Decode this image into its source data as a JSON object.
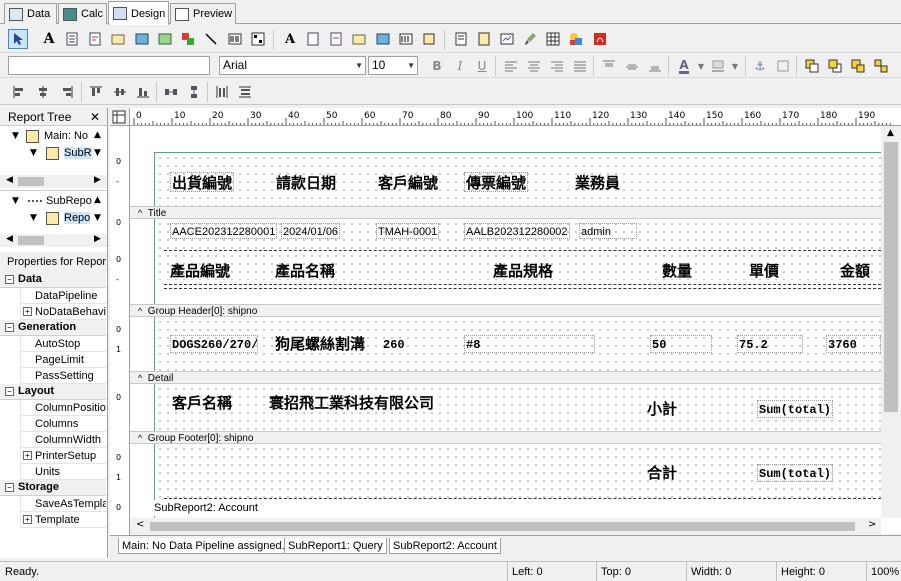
{
  "tabs": [
    {
      "label": "Data"
    },
    {
      "label": "Calc"
    },
    {
      "label": "Design"
    },
    {
      "label": "Preview"
    }
  ],
  "format": {
    "font_name": "Arial",
    "font_size": "10",
    "style_value": ""
  },
  "tree": {
    "title": "Report Tree",
    "nodes": [
      "Main: No",
      "SubR",
      "SubRepo",
      "Repo"
    ]
  },
  "props": {
    "title": "Properties for Repor",
    "sections": [
      {
        "name": "Data",
        "items": [
          "DataPipeline",
          "NoDataBehavio"
        ]
      },
      {
        "name": "Generation",
        "items": [
          "AutoStop",
          "PageLimit",
          "PassSetting"
        ]
      },
      {
        "name": "Layout",
        "items": [
          "ColumnPosition",
          "Columns",
          "ColumnWidth",
          "PrinterSetup",
          "Units"
        ]
      },
      {
        "name": "Storage",
        "items": [
          "SaveAsTempla",
          "Template"
        ]
      }
    ]
  },
  "ruler": [
    "0",
    "10",
    "20",
    "30",
    "40",
    "50",
    "60",
    "70",
    "80",
    "90",
    "100",
    "110",
    "120",
    "130",
    "140",
    "150",
    "160",
    "170",
    "180",
    "190"
  ],
  "bands": {
    "title": "Title",
    "group_header": "Group Header[0]: shipno",
    "detail": "Detail",
    "group_footer": "Group Footer[0]: shipno",
    "subreport": "SubReport2: Account"
  },
  "title_labels": [
    "出貨編號",
    "請款日期",
    "客戶編號",
    "傳票編號",
    "業務員"
  ],
  "title_values": [
    "AACE202312280001",
    "2024/01/06",
    "TMAH-0001",
    "AALB202312280002",
    "admin"
  ],
  "group_labels": [
    "產品編號",
    "產品名稱",
    "產品規格",
    "數量",
    "單價",
    "金額"
  ],
  "detail_values": [
    "DOGS260/270/",
    "狗尾螺絲割溝",
    "260",
    "#8",
    "50",
    "75.2",
    "3760"
  ],
  "footer": {
    "customer_label": "客戶名稱",
    "customer_value": "寰招飛工業科技有限公司",
    "subtotal_label": "小計",
    "sum_label": "Sum(total)"
  },
  "summary": {
    "total_label": "合計",
    "sum_label": "Sum(total)"
  },
  "bottom_tabs": [
    "Main: No Data Pipeline assigned.",
    "SubReport1: Query",
    "SubReport2: Account"
  ],
  "status": {
    "ready": "Ready.",
    "left": "Left: 0",
    "top": "Top: 0",
    "width": "Width: 0",
    "height": "Height: 0",
    "zoom": "100%"
  }
}
